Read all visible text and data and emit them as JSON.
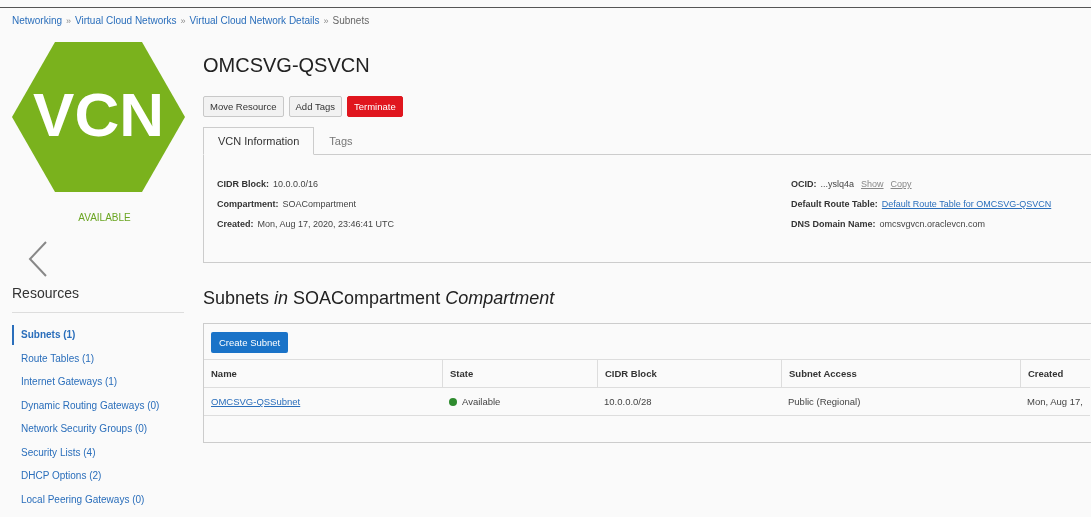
{
  "breadcrumb": [
    {
      "label": "Networking",
      "link": true
    },
    {
      "label": "Virtual Cloud Networks",
      "link": true
    },
    {
      "label": "Virtual Cloud Network Details",
      "link": true
    },
    {
      "label": "Subnets",
      "link": false
    }
  ],
  "breadcrumb_separator": "»",
  "logo": {
    "text": "VCN",
    "status": "AVAILABLE"
  },
  "resources": {
    "title": "Resources",
    "items": [
      {
        "label": "Subnets (1)",
        "selected": true
      },
      {
        "label": "Route Tables (1)",
        "selected": false
      },
      {
        "label": "Internet Gateways (1)",
        "selected": false
      },
      {
        "label": "Dynamic Routing Gateways (0)",
        "selected": false
      },
      {
        "label": "Network Security Groups (0)",
        "selected": false
      },
      {
        "label": "Security Lists (4)",
        "selected": false
      },
      {
        "label": "DHCP Options (2)",
        "selected": false
      },
      {
        "label": "Local Peering Gateways (0)",
        "selected": false
      }
    ]
  },
  "title": "OMCSVG-QSVCN",
  "actions": [
    {
      "label": "Move Resource",
      "kind": "default"
    },
    {
      "label": "Add Tags",
      "kind": "default"
    },
    {
      "label": "Terminate",
      "kind": "danger"
    }
  ],
  "tabs": [
    {
      "label": "VCN Information",
      "selected": true
    },
    {
      "label": "Tags",
      "selected": false
    }
  ],
  "info_left": [
    {
      "label": "CIDR Block:",
      "value": "10.0.0.0/16"
    },
    {
      "label": "Compartment:",
      "value": "SOACompartment"
    },
    {
      "label": "Created:",
      "value": "Mon, Aug 17, 2020, 23:46:41 UTC"
    }
  ],
  "info_right": [
    {
      "label": "OCID:",
      "value": "...yslq4a",
      "actions": [
        "Show",
        "Copy"
      ]
    },
    {
      "label": "Default Route Table:",
      "link": "Default Route Table for OMCSVG-QSVCN"
    },
    {
      "label": "DNS Domain Name:",
      "value": "omcsvgvcn.oraclevcn.com"
    }
  ],
  "section_heading": "Subnets *in* SOACompartment *Compartment*",
  "create_button": "Create Subnet",
  "table": {
    "columns": [
      "Name",
      "State",
      "CIDR Block",
      "Subnet Access",
      "Created"
    ],
    "rows": [
      {
        "name": "OMCSVG-QSSubnet",
        "state": "Available",
        "color": "#2e8b2e",
        "cidr": "10.0.0.0/28",
        "access": "Public (Regional)",
        "created": "Mon, Aug 17,"
      }
    ]
  }
}
